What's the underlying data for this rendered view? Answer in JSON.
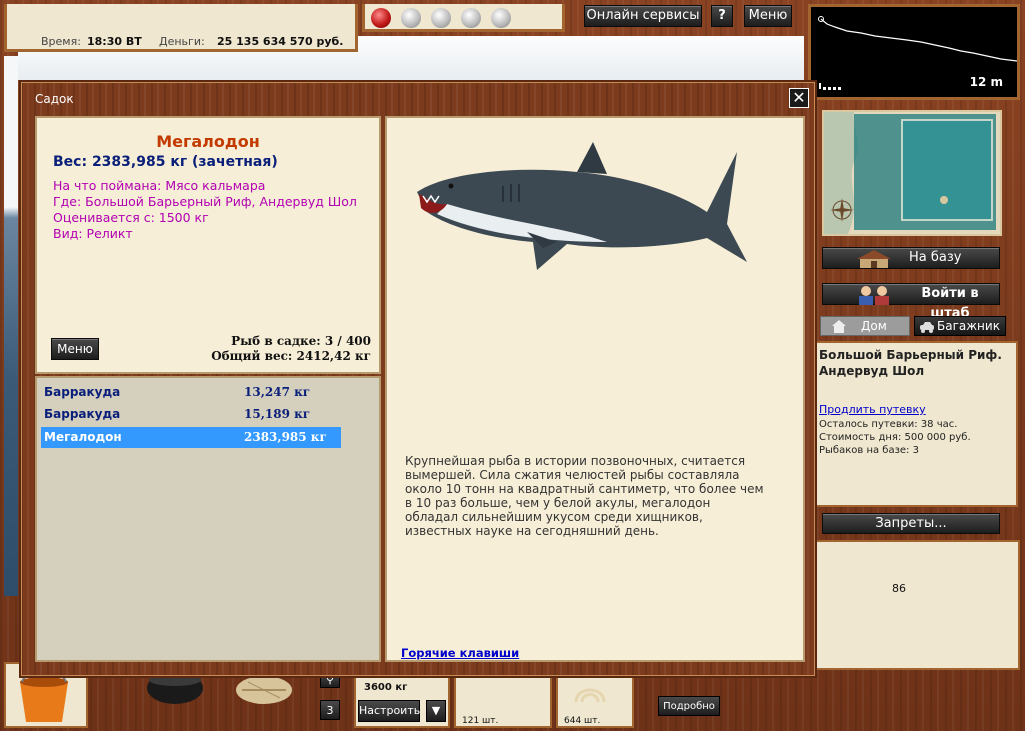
{
  "topbar": {
    "time_label": "Время:",
    "time_value": "18:30 ВТ",
    "money_label": "Деньги:",
    "money_value": "25 135 634 570 руб.",
    "online_services": "Онлайн сервисы",
    "help": "?",
    "menu": "Меню"
  },
  "depth": {
    "value": "12 m"
  },
  "right": {
    "to_base": "На базу",
    "enter_hq": "Войти в штаб",
    "home": "Дом",
    "trunk": "Багажник",
    "place_name": "Большой Барьерный Риф. Андервуд Шол",
    "extend_link": "Продлить путевку",
    "days_left": "Осталось путевки: 38 час.",
    "day_cost": "Стоимость дня: 500 000 руб.",
    "anglers": "Рыбаков на базе: 3",
    "bans": "Запреты...",
    "bottom_number": "86"
  },
  "bottom": {
    "weight_label": "3600 кг",
    "count_3": "3",
    "setup": "Настроить",
    "items_121": "121 шт.",
    "items_644": "644 шт.",
    "details": "Подробно"
  },
  "modal": {
    "title": "Садок",
    "close": "✕",
    "fish": {
      "name": "Мегалодон",
      "weight": "Вес: 2383,985 кг (зачетная)",
      "caught_on": "На что поймана: Мясо кальмара",
      "where": "Где: Большой Барьерный Риф, Андервуд Шол",
      "valued_from": "Оценивается с: 1500 кг",
      "type": "Вид: Реликт",
      "description": "Крупнейшая рыба в истории позвоночных, считается вымершей. Сила сжатия челюстей рыбы составляла около 10 тонн на квадратный сантиметр, что более чем в 10 раз больше, чем у белой акулы, мегалодон обладал сильнейшим укусом среди хищников, известных науке на сегодняшний день."
    },
    "menu_button": "Меню",
    "keepnet_count": "Рыб в садке: 3 / 400",
    "total_weight": "Общий вес: 2412,42 кг",
    "list": [
      {
        "name": "Барракуда",
        "weight": "13,247 кг"
      },
      {
        "name": "Барракуда",
        "weight": "15,189 кг"
      },
      {
        "name": "Мегалодон",
        "weight": "2383,985 кг"
      }
    ],
    "hotkeys": "Горячие клавиши"
  }
}
